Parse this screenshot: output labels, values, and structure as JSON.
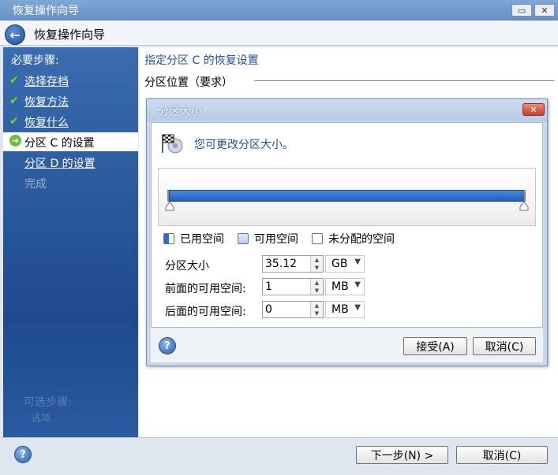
{
  "window": {
    "title": "恢复操作向导"
  },
  "header": {
    "title": "恢复操作向导"
  },
  "sidebar": {
    "heading": "必要步骤:",
    "items": [
      {
        "label": "选择存档",
        "state": "done"
      },
      {
        "label": "恢复方法",
        "state": "done"
      },
      {
        "label": "恢复什么",
        "state": "done"
      },
      {
        "label": "分区 C 的设置",
        "state": "active"
      },
      {
        "label": "分区 D 的设置",
        "state": "pending"
      },
      {
        "label": "完成",
        "state": "disabled"
      }
    ],
    "faded_heading": "可选步骤:",
    "faded_item": "选项"
  },
  "main": {
    "title": "指定分区 C 的恢复设置",
    "section_label": "分区位置（要求）"
  },
  "dialog": {
    "title": "分区大小",
    "message": "您可更改分区大小。",
    "legend": {
      "used": "已用空间",
      "free": "可用空间",
      "unallocated": "未分配的空间"
    },
    "fields": [
      {
        "label": "分区大小",
        "value": "35.12",
        "unit": "GB"
      },
      {
        "label": "前面的可用空间:",
        "value": "1",
        "unit": "MB"
      },
      {
        "label": "后面的可用空间:",
        "value": "0",
        "unit": "MB"
      }
    ],
    "accept_label": "接受(A)",
    "cancel_label": "取消(C)"
  },
  "footer": {
    "next_label": "下一步(N) >",
    "cancel_label": "取消(C)"
  },
  "colors": {
    "accent": "#1f4f9c",
    "sidebar": "#2a5aa0",
    "check": "#7ed321"
  }
}
